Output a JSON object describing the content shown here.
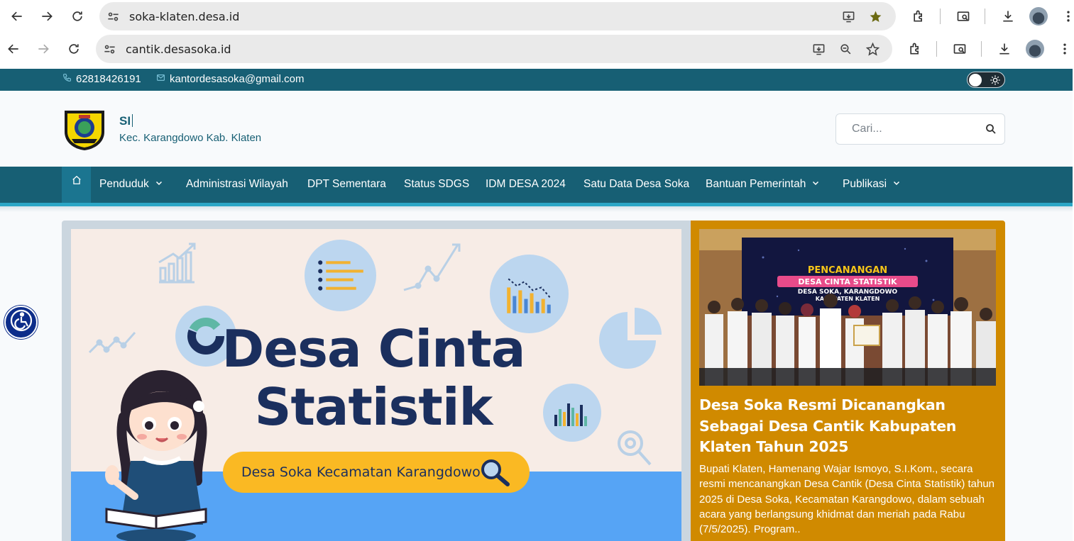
{
  "browser_top": {
    "url": "soka-klaten.desa.id"
  },
  "browser_bottom": {
    "url": "cantik.desasoka.id"
  },
  "topbar": {
    "phone": "62818426191",
    "email": "kantordesasoka@gmail.com"
  },
  "header": {
    "site_title": "SI",
    "site_subtitle": "Kec. Karangdowo Kab. Klaten",
    "search_placeholder": "Cari..."
  },
  "nav": {
    "items": [
      {
        "label": "Penduduk",
        "dropdown": true
      },
      {
        "label": "Administrasi Wilayah",
        "dropdown": false
      },
      {
        "label": "DPT Sementara",
        "dropdown": false
      },
      {
        "label": "Status SDGS",
        "dropdown": false
      },
      {
        "label": "IDM DESA 2024",
        "dropdown": false
      },
      {
        "label": "Satu Data Desa Soka",
        "dropdown": false
      },
      {
        "label": "Bantuan Pemerintah",
        "dropdown": true
      },
      {
        "label": "Publikasi",
        "dropdown": true
      }
    ]
  },
  "banner": {
    "title_line1": "Desa Cinta",
    "title_line2": "Statistik",
    "pill_text": "Desa Soka Kecamatan Karangdowo"
  },
  "news": {
    "photo_banner_line1": "PENCANANGAN",
    "photo_banner_line2": "DESA CINTA STATISTIK",
    "photo_banner_line3": "DESA SOKA, KARANGDOWO",
    "photo_banner_line4": "KABUPATEN KLATEN",
    "title": "Desa Soka Resmi Dicanangkan Sebagai Desa Cantik Kabupaten Klaten Tahun 2025",
    "body": "Bupati Klaten, Hamenang Wajar Ismoyo, S.I.Kom., secara resmi mencanangkan Desa Cantik (Desa Cinta Statistik) tahun 2025 di Desa Soka, Kecamatan Karangdowo, dalam sebuah acara yang berlangsung khidmat dan meriah pada Rabu (7/5/2025). Program.."
  },
  "colors": {
    "primary": "#175f74",
    "accent": "#2aa6c6",
    "news_card": "#d08a00",
    "banner_navy": "#1b2f5e",
    "banner_yellow": "#fab923"
  }
}
